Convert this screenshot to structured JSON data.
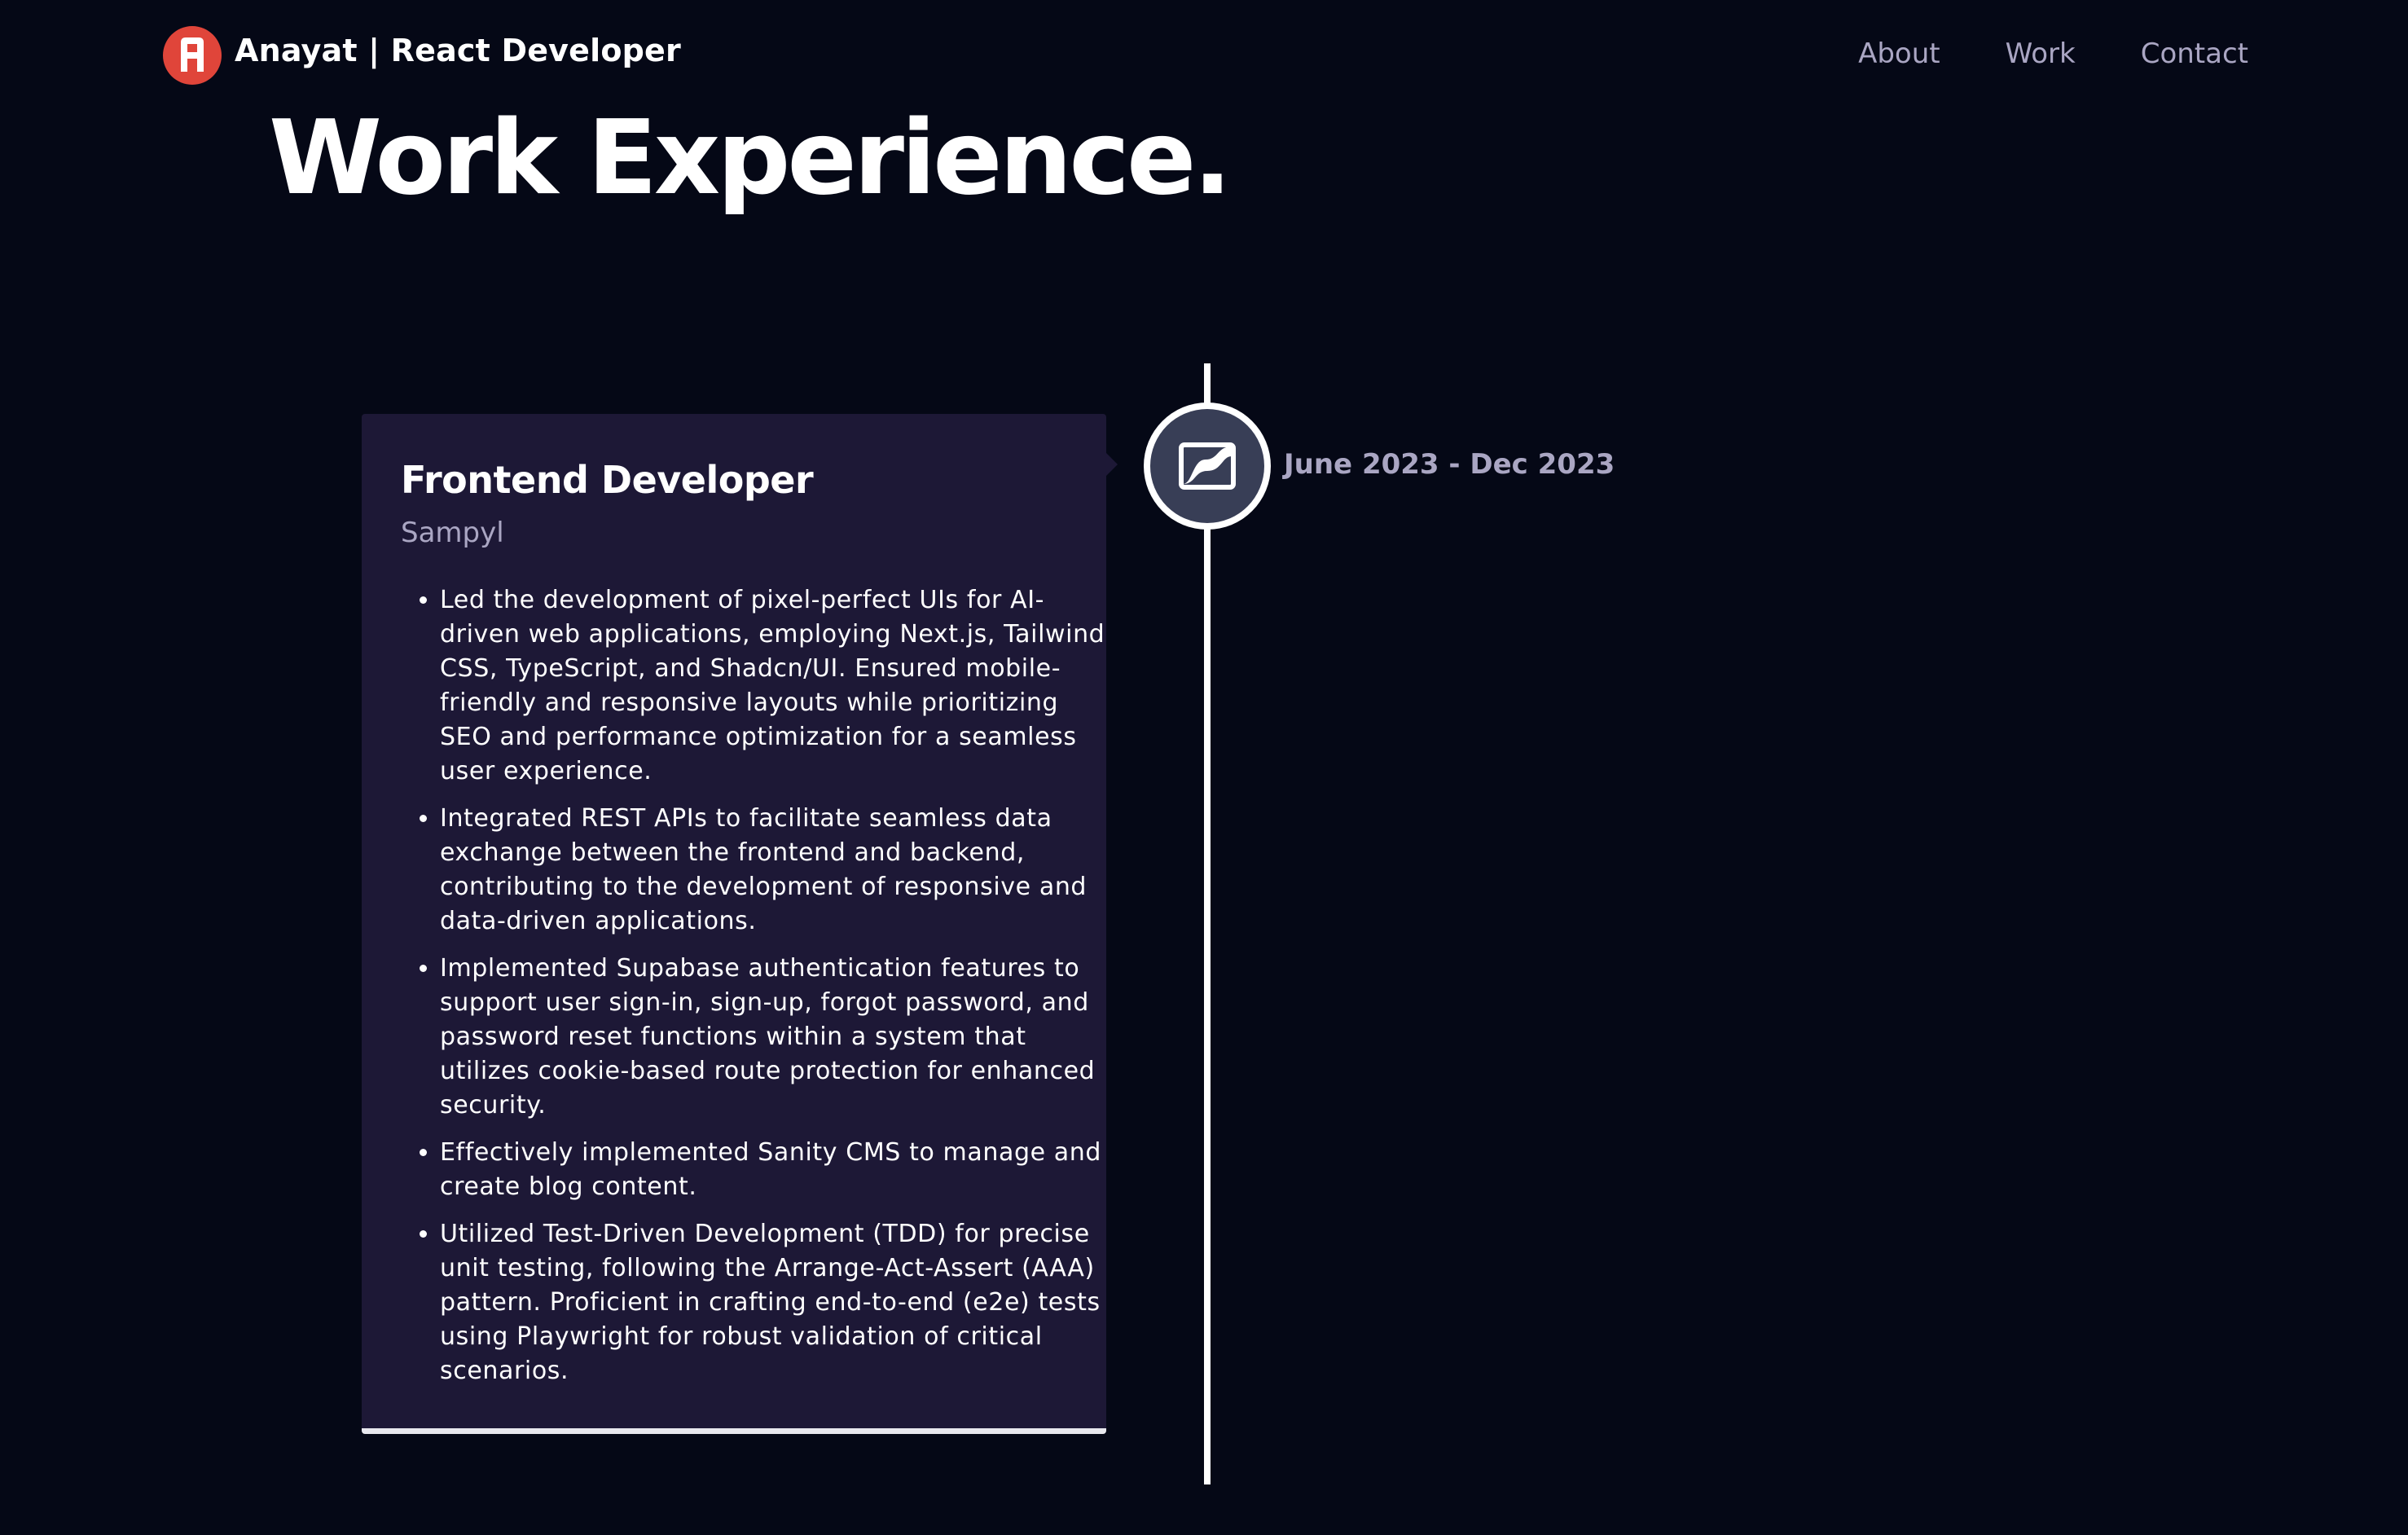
{
  "nav": {
    "logo_letter": "A",
    "brand": "Anayat  | React Developer",
    "links": [
      "About",
      "Work",
      "Contact"
    ]
  },
  "section": {
    "title": "Work Experience."
  },
  "experience": {
    "role": "Frontend Developer",
    "company": "Sampyl",
    "date": "June 2023 - Dec 2023",
    "icon": "company-logo-icon",
    "points": [
      "Led the development of pixel-perfect UIs for AI-driven web applications, employing Next.js, Tailwind CSS, TypeScript, and Shadcn/UI. Ensured mobile-friendly and responsive layouts while prioritizing SEO and performance optimization for a seamless user experience.",
      "Integrated REST APIs to facilitate seamless data exchange between the frontend and backend, contributing to the development of responsive and data-driven applications.",
      "Implemented Supabase authentication features to support user sign-in, sign-up, forgot password, and password reset functions within a system that utilizes cookie-based route protection for enhanced security.",
      "Effectively implemented Sanity CMS to manage and create blog content.",
      "Utilized Test-Driven Development (TDD) for precise unit testing, following the Arrange-Act-Assert (AAA) pattern. Proficient in crafting end-to-end (e2e) tests using Playwright for robust validation of critical scenarios."
    ]
  },
  "colors": {
    "background": "#050816",
    "card": "#1d1836",
    "secondary_text": "#aaa6c3",
    "logo": "#e0453a",
    "icon_bg": "#383e56"
  }
}
